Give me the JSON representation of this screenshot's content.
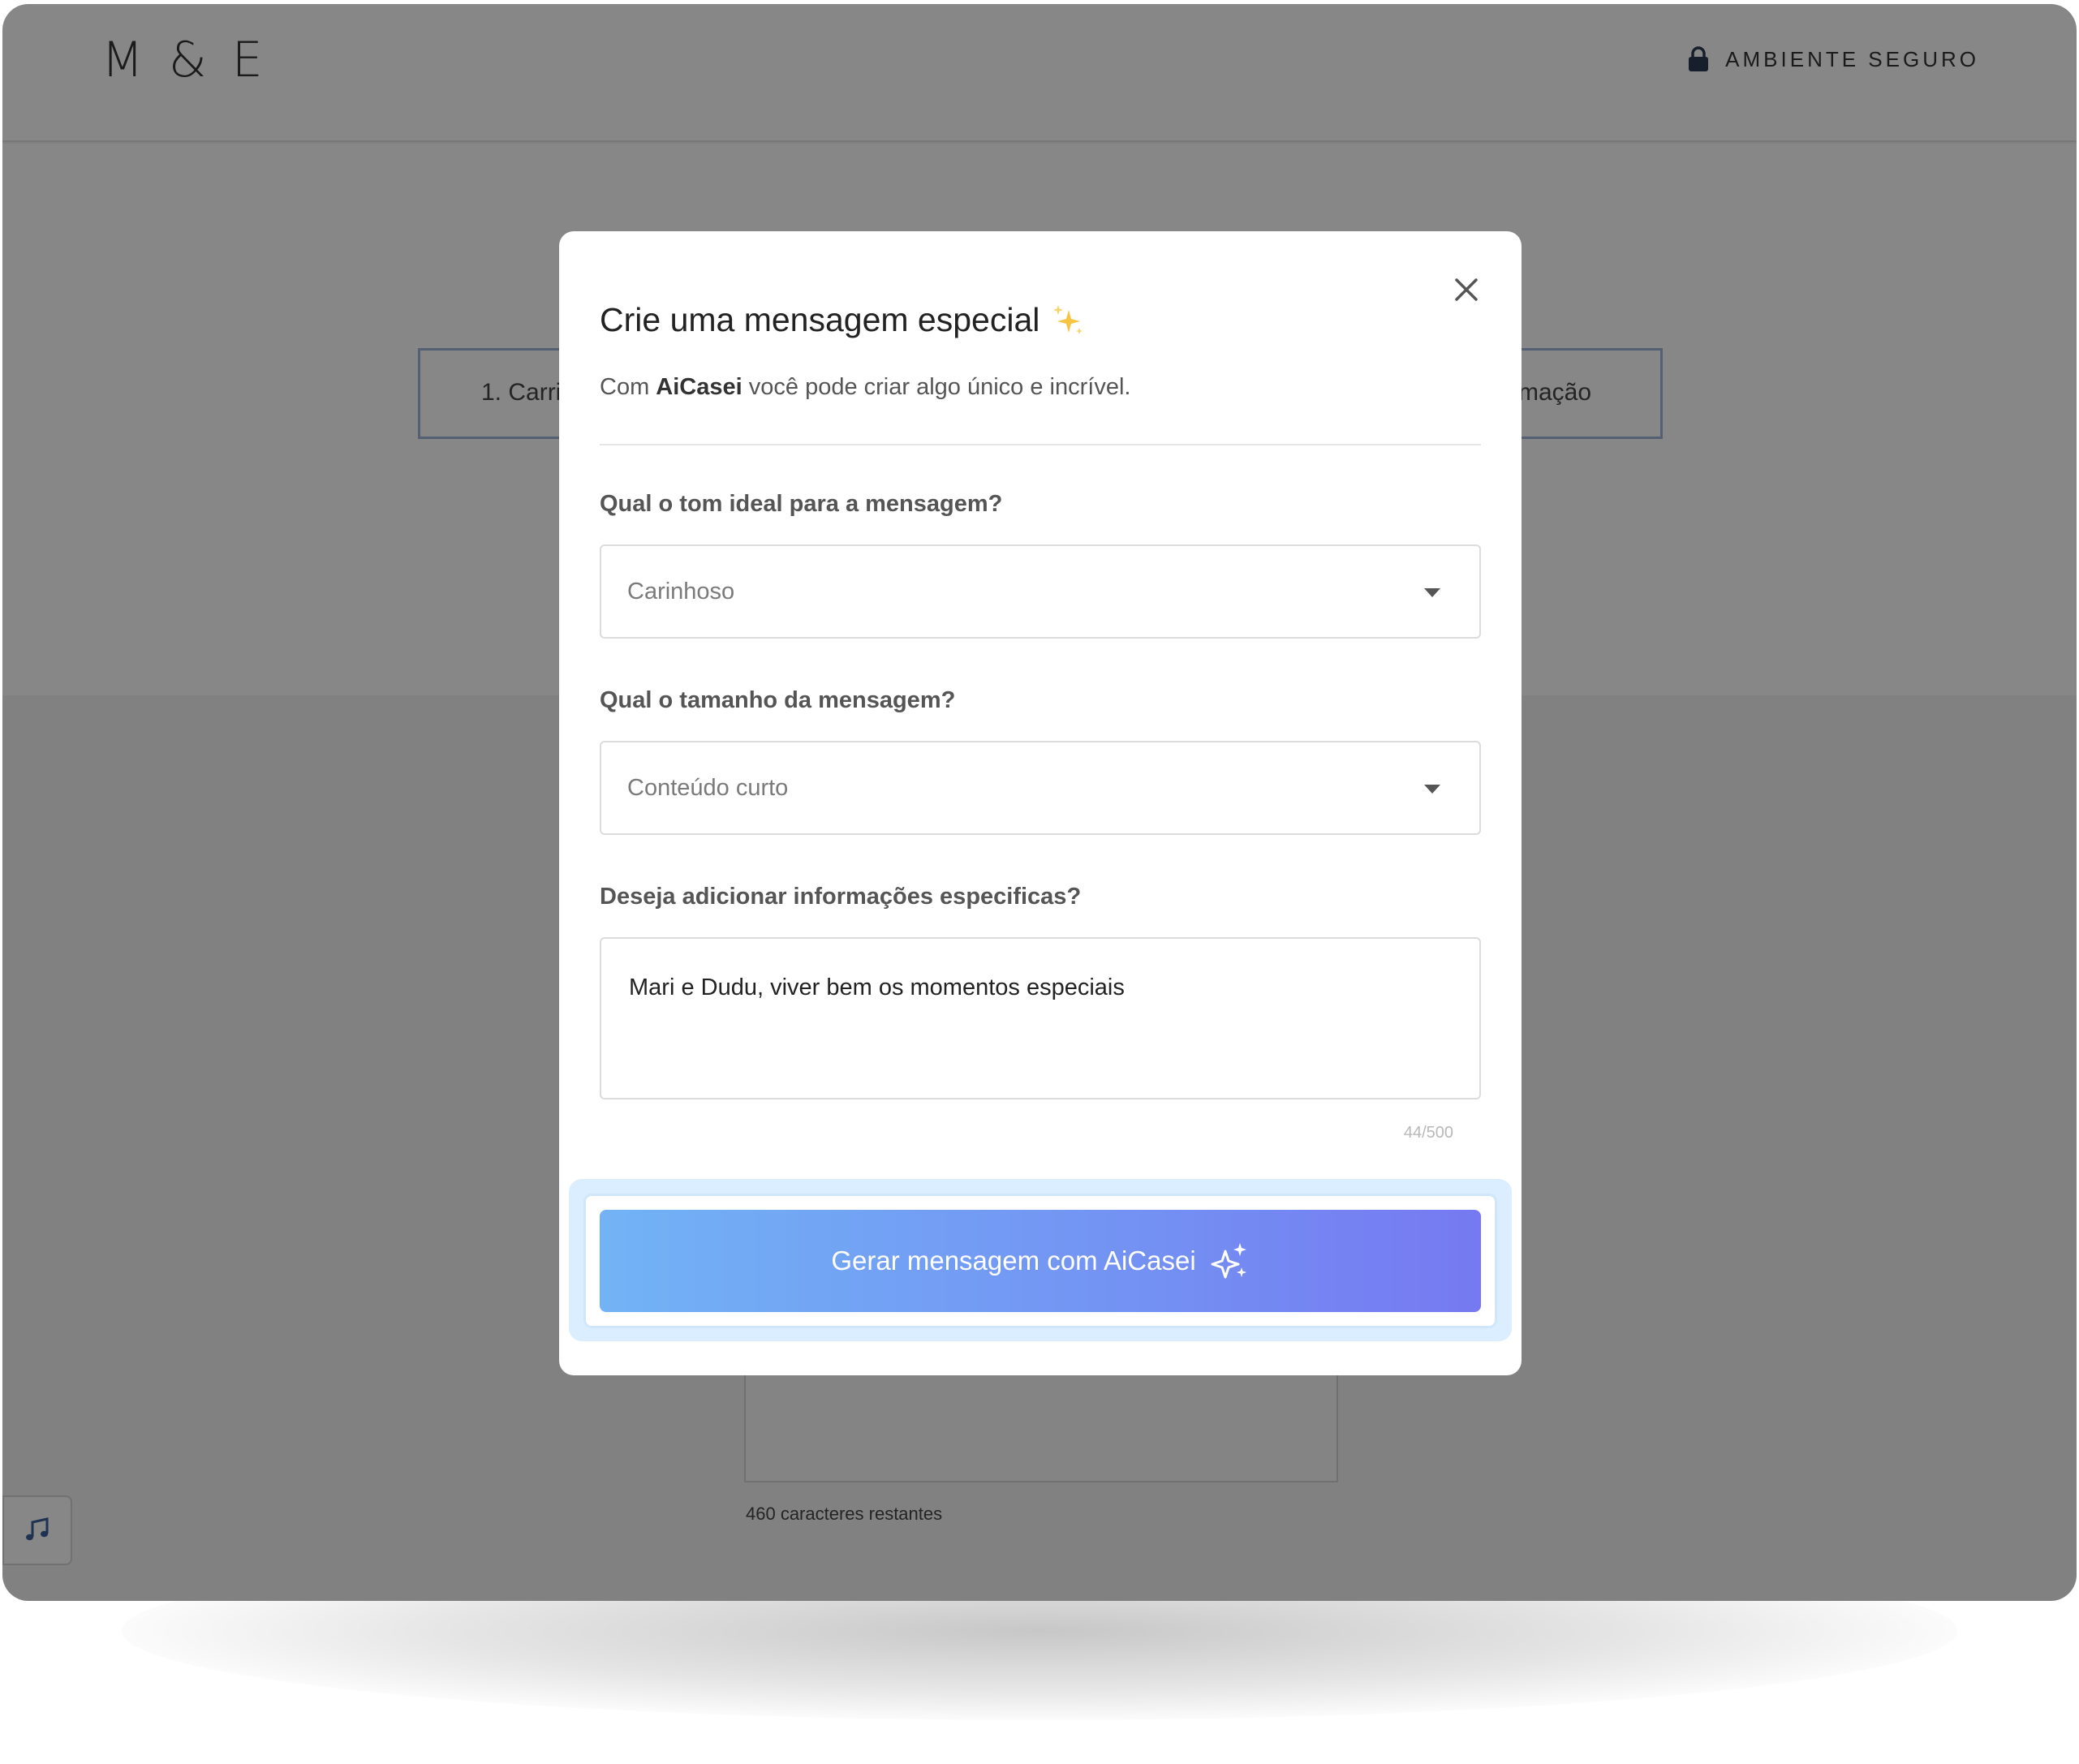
{
  "header": {
    "logo": "M & E",
    "secure_label": "AMBIENTE SEGURO"
  },
  "background": {
    "step1_label": "1. Carri",
    "step3_label": "mação",
    "remaining_label": "460 caracteres restantes"
  },
  "modal": {
    "title": "Crie uma mensagem especial",
    "subtitle_prefix": "Com",
    "subtitle_brand": "AiCasei",
    "subtitle_suffix": "você pode criar algo único e incrível.",
    "tone": {
      "label": "Qual o tom ideal para a mensagem?",
      "value": "Carinhoso"
    },
    "size": {
      "label": "Qual o tamanho da mensagem?",
      "value": "Conteúdo curto"
    },
    "info": {
      "label": "Deseja adicionar informações especificas?",
      "value": "Mari e Dudu, viver bem os momentos especiais",
      "counter": "44/500"
    },
    "generate_label": "Gerar mensagem com AiCasei"
  },
  "colors": {
    "accent_start": "#72b3f5",
    "accent_end": "#7679f1",
    "sparkle": "#f5c542"
  }
}
